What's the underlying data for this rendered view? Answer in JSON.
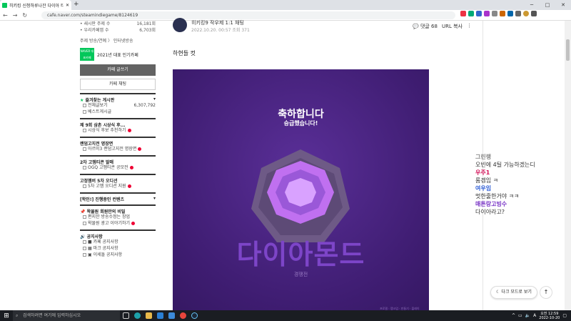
{
  "browser": {
    "tab_title": "히키킹 신청하루나잔 다이아 티",
    "newtab": "+",
    "url": "cafe.naver.com/steamindiegame/8124619",
    "nav": [
      "←",
      "→",
      "↻"
    ],
    "window_controls": [
      "─",
      "□",
      "✕"
    ]
  },
  "sidebar": {
    "stats": [
      {
        "label": "• 새시판 주제 수",
        "value": "16,181회"
      },
      {
        "label": "• 우리카페앱 수",
        "value": "6,703회"
      }
    ],
    "topic": "주제  방송/연예 〉 인터넷방송",
    "award_badge": "NAVER 대표카페",
    "award_text": "2021년 대표 인기카페",
    "write_btn": "카페 글쓰기",
    "chat_btn": "카페 채팅",
    "fav_title": "즐겨찾는 게시판",
    "fav_items": [
      {
        "label": "전체글보기",
        "count": "6,307,792"
      },
      {
        "label": "베스트게시글",
        "count": ""
      }
    ],
    "sections": [
      {
        "title": "제 9회 삼촌 시상식 후...",
        "items": [
          "시상식 후보 추천하기"
        ]
      },
      {
        "title": "랜덤고지전 명장면",
        "items": [
          "아르미3 랜덤고지전 명장면"
        ]
      },
      {
        "title": "2차 고멤티콘 발매",
        "items": [
          "OGQ 고멤티콘 공모전"
        ]
      },
      {
        "title": "고정멤버 5차 오디션",
        "items": [
          "5차 고멤 오디션 지원"
        ]
      },
      {
        "title": "[학인!] 진행중인 컨텐츠",
        "items": []
      },
      {
        "title": "왁물원 회원만의 비밀",
        "items": [
          "편지한 방송수정는 창업",
          "왁물원 광고 이야기하기"
        ]
      },
      {
        "title": "공지사항",
        "items": [
          "■ 카페 공지사항",
          "▦ 마크 공지사항",
          "▣ 이세돌 공지사항"
        ]
      }
    ]
  },
  "article": {
    "author": "히키킹9  작우제  1:1 채팅",
    "meta": "2022.10.20. 00:57  조회 371",
    "comments": "💬 댓글 68",
    "url_copy": "URL 복사",
    "more": "⋮",
    "body": "하현들 컷",
    "image": {
      "t1": "축하합니다",
      "t2": "승급했습니다!",
      "big": "다이아몬드",
      "sub": "경쟁전",
      "credit": "프로필 · 랭크업 · 만들기 · 플레이"
    }
  },
  "chat": [
    {
      "name": "그린랭",
      "msg": "오빈에 4틸 가능하겠는디",
      "color": "#888888"
    },
    {
      "name": "우주1",
      "msg": "롬겜임 ㅋ",
      "color": "#d4145a"
    },
    {
      "name": "여우임",
      "msg": "멋한줄한거야 ㅋㅋ",
      "color": "#2a5bd7"
    },
    {
      "name": "매튼랑고빙수",
      "msg": "다이아라고?",
      "color": "#7a36c7"
    }
  ],
  "dark_mode": "다크 모드로 보기",
  "top_btn": "↑",
  "taskbar": {
    "start": "⊞",
    "search": "검색하려면 여기에 입력하십시오",
    "time": "오전 12:59",
    "date": "2022-10-20"
  }
}
